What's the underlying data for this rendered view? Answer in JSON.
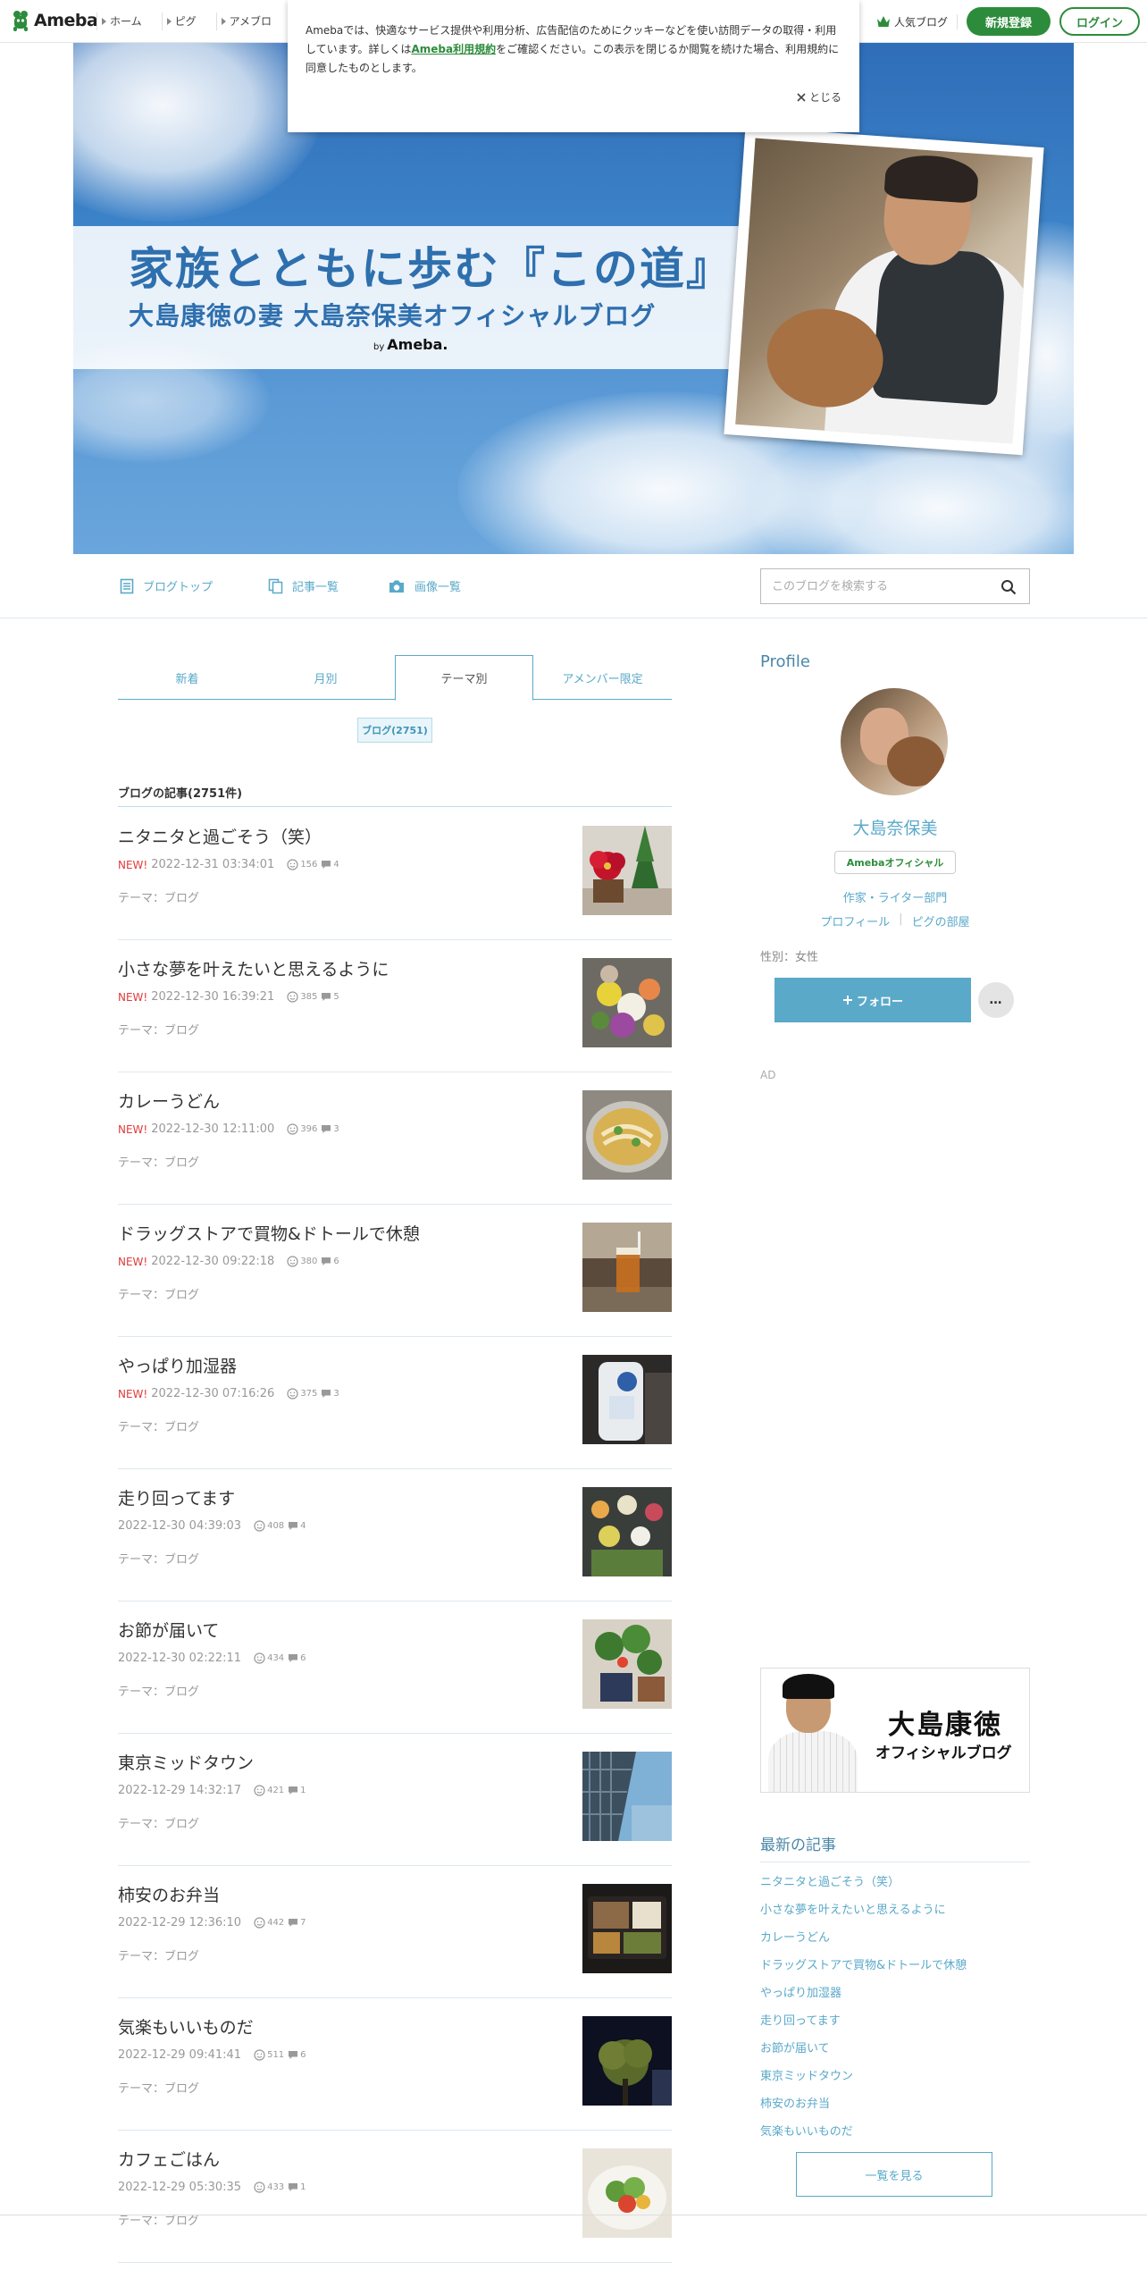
{
  "header": {
    "logo_text": "Ameba",
    "nav": [
      {
        "label": "ホーム"
      },
      {
        "label": "ピグ"
      },
      {
        "label": "アメブロ"
      }
    ],
    "popular_label": "人気ブログ",
    "register_label": "新規登録",
    "login_label": "ログイン"
  },
  "cookie": {
    "text_before": "Amebaでは、快適なサービス提供や利用分析、広告配信のためにクッキーなどを使い訪問データの取得・利用しています。詳しくは",
    "link_text": "Ameba利用規約",
    "text_after": "をご確認ください。この表示を閉じるか閲覧を続けた場合、利用規約に同意したものとします。",
    "close_label": "とじる"
  },
  "hero": {
    "title": "家族とともに歩む『この道』",
    "subtitle": "大島康徳の妻 大島奈保美オフィシャルブログ",
    "by": "by",
    "by_brand": "Ameba."
  },
  "blognav": {
    "top_label": "ブログトップ",
    "list_label": "記事一覧",
    "images_label": "画像一覧",
    "search_placeholder": "このブログを検索する"
  },
  "tabs": [
    {
      "label": "新着"
    },
    {
      "label": "月別"
    },
    {
      "label": "テーマ別"
    },
    {
      "label": "アメンバー限定"
    }
  ],
  "theme_chip": "ブログ(2751)",
  "list_heading": "ブログの記事(2751件)",
  "new_label": "NEW!",
  "articles": [
    {
      "title": "ニタニタと過ごそう（笑）",
      "new": true,
      "datetime": "2022-12-31 03:34:01",
      "likes": "156",
      "comments": "4",
      "theme": "テーマ：ブログ"
    },
    {
      "title": "小さな夢を叶えたいと思えるように",
      "new": true,
      "datetime": "2022-12-30 16:39:21",
      "likes": "385",
      "comments": "5",
      "theme": "テーマ：ブログ"
    },
    {
      "title": "カレーうどん",
      "new": true,
      "datetime": "2022-12-30 12:11:00",
      "likes": "396",
      "comments": "3",
      "theme": "テーマ：ブログ"
    },
    {
      "title": "ドラッグストアで買物&ドトールで休憩",
      "new": true,
      "datetime": "2022-12-30 09:22:18",
      "likes": "380",
      "comments": "6",
      "theme": "テーマ：ブログ"
    },
    {
      "title": "やっぱり加湿器",
      "new": true,
      "datetime": "2022-12-30 07:16:26",
      "likes": "375",
      "comments": "3",
      "theme": "テーマ：ブログ"
    },
    {
      "title": "走り回ってます",
      "new": false,
      "datetime": "2022-12-30 04:39:03",
      "likes": "408",
      "comments": "4",
      "theme": "テーマ：ブログ"
    },
    {
      "title": "お節が届いて",
      "new": false,
      "datetime": "2022-12-30 02:22:11",
      "likes": "434",
      "comments": "6",
      "theme": "テーマ：ブログ"
    },
    {
      "title": "東京ミッドタウン",
      "new": false,
      "datetime": "2022-12-29 14:32:17",
      "likes": "421",
      "comments": "1",
      "theme": "テーマ：ブログ"
    },
    {
      "title": "柿安のお弁当",
      "new": false,
      "datetime": "2022-12-29 12:36:10",
      "likes": "442",
      "comments": "7",
      "theme": "テーマ：ブログ"
    },
    {
      "title": "気楽もいいものだ",
      "new": false,
      "datetime": "2022-12-29 09:41:41",
      "likes": "511",
      "comments": "6",
      "theme": "テーマ：ブログ"
    },
    {
      "title": "カフェごはん",
      "new": false,
      "datetime": "2022-12-29 05:30:35",
      "likes": "433",
      "comments": "1",
      "theme": "テーマ：ブログ"
    }
  ],
  "profile": {
    "heading": "Profile",
    "name": "大島奈保美",
    "badge": "Amebaオフィシャル",
    "category": "作家・ライター部門",
    "profile_link": "プロフィール",
    "pigg_link": "ピグの部屋",
    "gender": "性別：女性",
    "follow_label": "フォロー",
    "more_label": "…"
  },
  "ad_label": "AD",
  "banner": {
    "line1": "大島康徳",
    "line2": "オフィシャルブログ"
  },
  "latest": {
    "heading": "最新の記事",
    "items": [
      "ニタニタと過ごそう（笑）",
      "小さな夢を叶えたいと思えるように",
      "カレーうどん",
      "ドラッグストアで買物&ドトールで休憩",
      "やっぱり加湿器",
      "走り回ってます",
      "お節が届いて",
      "東京ミッドタウン",
      "柿安のお弁当",
      "気楽もいいものだ"
    ],
    "see_all": "一覧を見る"
  },
  "colors": {
    "accent": "#5aa9c9",
    "brand_green": "#2d8c3c",
    "new_red": "#e03b3b"
  }
}
